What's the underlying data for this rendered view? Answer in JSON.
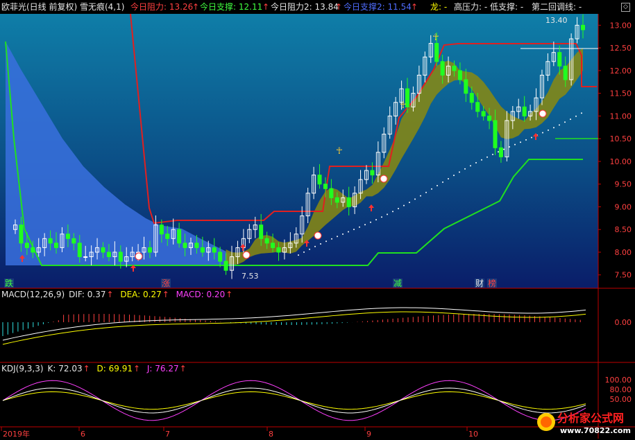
{
  "header": {
    "title": "欧菲光(日线 前复权) 雪无痕(4,1)",
    "resist_label": "今日阻力: 13.26",
    "resist_arrow": "↑",
    "support_label": "今日支撑: 12.11",
    "support_arrow": "↑",
    "resist2_label": "今日阻力2: 13.84",
    "resist2_arrow": "↑",
    "support2_label": "今日支撑2: 11.54",
    "support2_arrow": "↑",
    "dragon_label": "龙: -",
    "highp_label": "高压力: -",
    "lowsup_label": "低支撑: -",
    "second_label": "第二回调线: -",
    "colors": {
      "white": "#e6e6e6",
      "red": "#ff4040",
      "green": "#40ff40",
      "blue": "#4f6dff",
      "yellow": "#ffff00"
    }
  },
  "chart_data": [
    {
      "type": "candlestick",
      "title": "欧菲光(日线 前复权)",
      "ylim": [
        7.45,
        13.25
      ],
      "y_ticks": [
        "13.00",
        "12.50",
        "12.00",
        "11.50",
        "11.00",
        "10.50",
        "10.00",
        "9.50",
        "9.00",
        "8.50",
        "8.00",
        "7.50"
      ],
      "y_tick_values": [
        13.0,
        12.5,
        12.0,
        11.5,
        11.0,
        10.5,
        10.0,
        9.5,
        9.0,
        8.5,
        8.0,
        7.5
      ],
      "annotations": {
        "max_label": "13.40",
        "min_label": "7.53"
      },
      "signals": [
        {
          "text": "跌",
          "color": "#40ff40"
        },
        {
          "text": "涨",
          "color": "#ff4040"
        },
        {
          "text": "减",
          "color": "#40ff40"
        },
        {
          "text": "财",
          "color": "#e6e6e6"
        },
        {
          "text": "榜",
          "color": "#ff4040"
        }
      ],
      "close_approx": [
        8.6,
        8.2,
        8.1,
        8.0,
        8.1,
        8.3,
        8.2,
        8.1,
        8.4,
        8.3,
        8.2,
        7.9,
        7.9,
        8.0,
        8.1,
        8.0,
        7.9,
        8.0,
        7.8,
        7.9,
        8.0,
        8.0,
        8.1,
        8.0,
        8.6,
        8.4,
        8.3,
        8.5,
        8.2,
        8.1,
        8.2,
        8.1,
        8.0,
        8.1,
        8.0,
        7.8,
        7.6,
        7.9,
        8.1,
        8.3,
        8.5,
        8.6,
        8.3,
        8.2,
        8.1,
        8.0,
        8.1,
        8.2,
        8.4,
        8.8,
        9.3,
        9.7,
        9.5,
        9.4,
        9.2,
        9.1,
        9.2,
        9.0,
        9.3,
        9.6,
        9.8,
        9.7,
        10.2,
        10.6,
        11.0,
        11.3,
        11.6,
        11.2,
        11.5,
        11.9,
        12.3,
        12.6,
        12.2,
        11.9,
        12.1,
        12.0,
        11.8,
        11.5,
        11.3,
        11.1,
        11.0,
        10.9,
        10.3,
        10.1,
        10.9,
        11.1,
        11.2,
        11.0,
        11.1,
        11.4,
        11.9,
        12.2,
        12.4,
        12.1,
        11.8,
        12.7,
        13.0,
        12.9
      ]
    },
    {
      "type": "line",
      "title": "MACD(12,26,9)",
      "header_values": {
        "dif": "DIF: 0.37",
        "dea": "DEA: 0.27",
        "macd": "MACD: 0.20"
      },
      "series": [
        {
          "name": "DIF"
        },
        {
          "name": "DEA"
        },
        {
          "name": "MACD"
        }
      ],
      "y_ticks": [
        "0.00"
      ]
    },
    {
      "type": "line",
      "title": "KDJ(9,3,3)",
      "header_values": {
        "k": "K: 72.03",
        "d": "D: 69.91",
        "j": "J: 76.27"
      },
      "series": [
        {
          "name": "K"
        },
        {
          "name": "D"
        },
        {
          "name": "J"
        }
      ],
      "y_ticks": [
        "100.00",
        "80.00",
        "50.00"
      ]
    }
  ],
  "x_axis": [
    "2019年",
    "6",
    "7",
    "8",
    "9",
    "10"
  ],
  "watermark": {
    "line1": "分析家公式网",
    "line2": "www.70822.com"
  }
}
